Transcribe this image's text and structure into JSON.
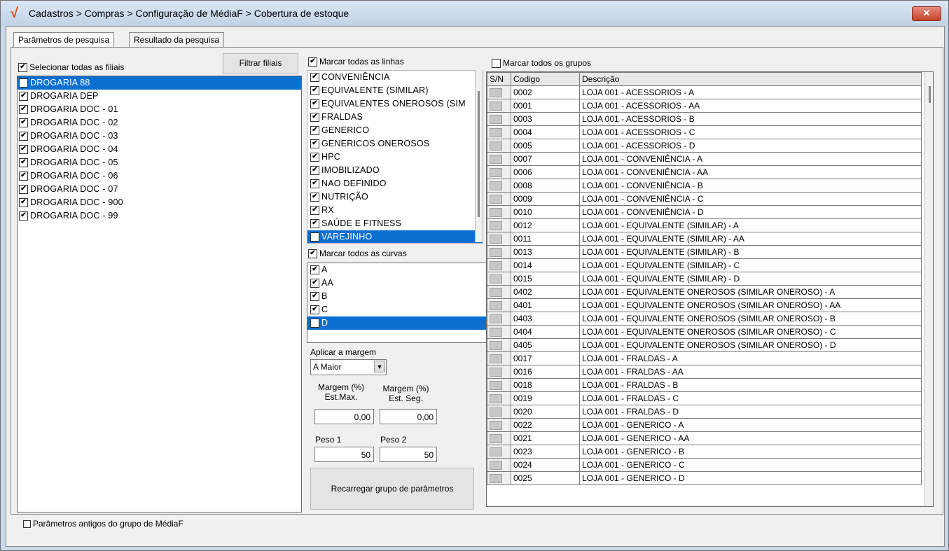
{
  "window": {
    "title": "Cadastros > Compras > Configuração de MédiaF > Cobertura de estoque",
    "logo_glyph": "√",
    "close_glyph": "✕"
  },
  "tabs": [
    {
      "label": "Parâmetros de pesquisa",
      "active": true
    },
    {
      "label": "Resultado da pesquisa",
      "active": false
    }
  ],
  "filiais": {
    "select_all_label": "Selecionar todas as filiais",
    "select_all_checked": true,
    "filter_button": "Filtrar filiais",
    "items": [
      {
        "label": "DROGARIA 88",
        "checked": true,
        "selected": true
      },
      {
        "label": "DROGARIA DEP",
        "checked": true
      },
      {
        "label": "DROGARIA DOC - 01",
        "checked": true
      },
      {
        "label": "DROGARIA DOC - 02",
        "checked": true
      },
      {
        "label": "DROGARIA DOC - 03",
        "checked": true
      },
      {
        "label": "DROGARIA DOC - 04",
        "checked": true
      },
      {
        "label": "DROGARIA DOC - 05",
        "checked": true
      },
      {
        "label": "DROGARIA DOC - 06",
        "checked": true
      },
      {
        "label": "DROGARIA DOC - 07",
        "checked": true
      },
      {
        "label": "DROGARIA DOC - 900",
        "checked": true
      },
      {
        "label": "DROGARIA DOC - 99",
        "checked": true
      }
    ]
  },
  "linhas": {
    "mark_all_label": "Marcar todas as linhas",
    "mark_all_checked": true,
    "items": [
      {
        "label": "CONVENIÊNCIA",
        "checked": true
      },
      {
        "label": "EQUIVALENTE (SIMILAR)",
        "checked": true
      },
      {
        "label": "EQUIVALENTES ONEROSOS (SIM",
        "checked": true
      },
      {
        "label": "FRALDAS",
        "checked": true
      },
      {
        "label": "GENERICO",
        "checked": true
      },
      {
        "label": "GENERICOS ONEROSOS",
        "checked": true
      },
      {
        "label": "HPC",
        "checked": true
      },
      {
        "label": "IMOBILIZADO",
        "checked": true
      },
      {
        "label": "NAO DEFINIDO",
        "checked": true
      },
      {
        "label": "NUTRIÇÃO",
        "checked": true
      },
      {
        "label": "RX",
        "checked": true
      },
      {
        "label": "SAÚDE E FITNESS",
        "checked": true
      },
      {
        "label": "VAREJINHO",
        "checked": true,
        "selected": true
      }
    ]
  },
  "curvas": {
    "mark_all_label": "Marcar todos as curvas",
    "mark_all_checked": true,
    "items": [
      {
        "label": "A",
        "checked": true
      },
      {
        "label": "AA",
        "checked": true
      },
      {
        "label": "B",
        "checked": true
      },
      {
        "label": "C",
        "checked": true
      },
      {
        "label": "D",
        "checked": true,
        "selected": true
      }
    ]
  },
  "margem": {
    "apply_label": "Aplicar a margem",
    "apply_value": "A Maior",
    "max_label_1": "Margem (%)",
    "max_label_2": "Est.Max.",
    "max_value": "0,00",
    "seg_label_1": "Margem (%)",
    "seg_label_2": "Est. Seg.",
    "seg_value": "0,00",
    "peso1_label": "Peso 1",
    "peso1_value": "50",
    "peso2_label": "Peso 2",
    "peso2_value": "50",
    "reload_button": "Recarregar grupo de parâmetros"
  },
  "grupos": {
    "mark_all_label": "Marcar todos os grupos",
    "mark_all_checked": false,
    "columns": [
      "S/N",
      "Codigo",
      "Descrição"
    ],
    "rows": [
      [
        "0002",
        "LOJA 001 - ACESSORIOS - A"
      ],
      [
        "0001",
        "LOJA 001 - ACESSORIOS - AA"
      ],
      [
        "0003",
        "LOJA 001 - ACESSORIOS - B"
      ],
      [
        "0004",
        "LOJA 001 - ACESSORIOS - C"
      ],
      [
        "0005",
        "LOJA 001 - ACESSORIOS - D"
      ],
      [
        "0007",
        "LOJA 001 - CONVENIÊNCIA - A"
      ],
      [
        "0006",
        "LOJA 001 - CONVENIÊNCIA - AA"
      ],
      [
        "0008",
        "LOJA 001 - CONVENIÊNCIA - B"
      ],
      [
        "0009",
        "LOJA 001 - CONVENIÊNCIA - C"
      ],
      [
        "0010",
        "LOJA 001 - CONVENIÊNCIA - D"
      ],
      [
        "0012",
        "LOJA 001 - EQUIVALENTE (SIMILAR) - A"
      ],
      [
        "0011",
        "LOJA 001 - EQUIVALENTE (SIMILAR) - AA"
      ],
      [
        "0013",
        "LOJA 001 - EQUIVALENTE (SIMILAR) - B"
      ],
      [
        "0014",
        "LOJA 001 - EQUIVALENTE (SIMILAR) - C"
      ],
      [
        "0015",
        "LOJA 001 - EQUIVALENTE (SIMILAR) - D"
      ],
      [
        "0402",
        "LOJA 001 - EQUIVALENTE ONEROSOS (SIMILAR ONEROSO) - A"
      ],
      [
        "0401",
        "LOJA 001 - EQUIVALENTE ONEROSOS (SIMILAR ONEROSO) - AA"
      ],
      [
        "0403",
        "LOJA 001 - EQUIVALENTE ONEROSOS (SIMILAR ONEROSO) - B"
      ],
      [
        "0404",
        "LOJA 001 - EQUIVALENTE ONEROSOS (SIMILAR ONEROSO) - C"
      ],
      [
        "0405",
        "LOJA 001 - EQUIVALENTE ONEROSOS (SIMILAR ONEROSO) - D"
      ],
      [
        "0017",
        "LOJA 001 - FRALDAS - A"
      ],
      [
        "0016",
        "LOJA 001 - FRALDAS - AA"
      ],
      [
        "0018",
        "LOJA 001 - FRALDAS - B"
      ],
      [
        "0019",
        "LOJA 001 - FRALDAS - C"
      ],
      [
        "0020",
        "LOJA 001 - FRALDAS - D"
      ],
      [
        "0022",
        "LOJA 001 - GENERICO - A"
      ],
      [
        "0021",
        "LOJA 001 - GENERICO - AA"
      ],
      [
        "0023",
        "LOJA 001 - GENERICO - B"
      ],
      [
        "0024",
        "LOJA 001 - GENERICO - C"
      ],
      [
        "0025",
        "LOJA 001 - GENERICO - D"
      ]
    ]
  },
  "footer": {
    "old_params_label": "Parâmetros antigos do grupo de MédiaF",
    "old_params_checked": false
  },
  "colors": {
    "selection": "#0a6fd0",
    "title_bar": "#c9d8ea",
    "close_button": "#c6432b"
  }
}
